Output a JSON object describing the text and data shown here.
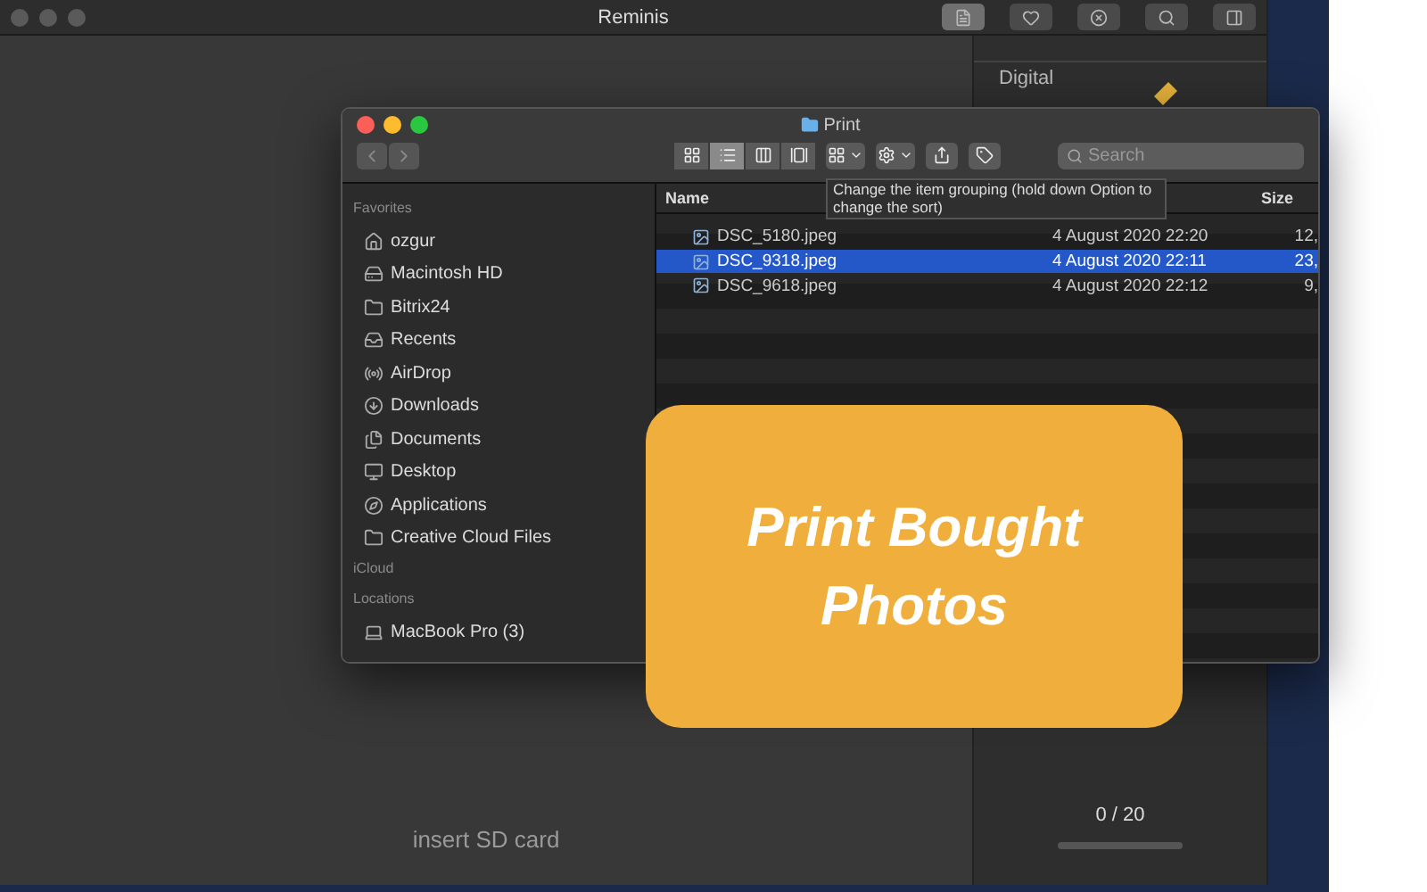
{
  "app_window": {
    "title": "Reminis",
    "toolbar": [
      {
        "kind": "document",
        "selected": true
      },
      {
        "kind": "heart",
        "selected": false
      },
      {
        "kind": "close",
        "selected": false
      },
      {
        "kind": "search",
        "selected": false
      },
      {
        "kind": "sidebar",
        "selected": false
      }
    ],
    "drop_hint": "insert SD card",
    "side_panel": {
      "heading": "Digital",
      "counter": "0 / 20",
      "progress": {
        "level": 0
      }
    }
  },
  "finder": {
    "title": "Print",
    "view_buttons": [
      {
        "kind": "icons",
        "selected": false
      },
      {
        "kind": "list",
        "selected": true
      },
      {
        "kind": "columns",
        "selected": false
      },
      {
        "kind": "gallery",
        "selected": false
      }
    ],
    "search": {
      "placeholder": "Search"
    },
    "tooltip": "Change the item grouping (hold down Option to change the sort)",
    "sidebar": [
      {
        "heading": "Favorites",
        "items": [
          {
            "label": "ozgur"
          },
          {
            "label": "Macintosh HD"
          },
          {
            "label": "Bitrix24"
          },
          {
            "label": "Recents"
          },
          {
            "label": "AirDrop"
          },
          {
            "label": "Downloads"
          },
          {
            "label": "Documents"
          },
          {
            "label": "Desktop"
          },
          {
            "label": "Applications"
          },
          {
            "label": "Creative Cloud Files"
          }
        ]
      },
      {
        "heading": "iCloud"
      },
      {
        "heading": "Locations",
        "items": [
          {
            "label": "MacBook Pro (3)"
          }
        ]
      }
    ],
    "columns": [
      "Name",
      "Size"
    ],
    "files": [
      {
        "name": "DSC_5180.jpeg",
        "date": "4 August 2020 22:20",
        "size": "12,",
        "selected": false
      },
      {
        "name": "DSC_9318.jpeg",
        "date": "4 August 2020 22:11",
        "size": "23,",
        "selected": true
      },
      {
        "name": "DSC_9618.jpeg",
        "date": "4 August 2020 22:12",
        "size": "9,",
        "selected": false
      }
    ]
  },
  "promo": {
    "headline": "Print Bought Photos"
  }
}
